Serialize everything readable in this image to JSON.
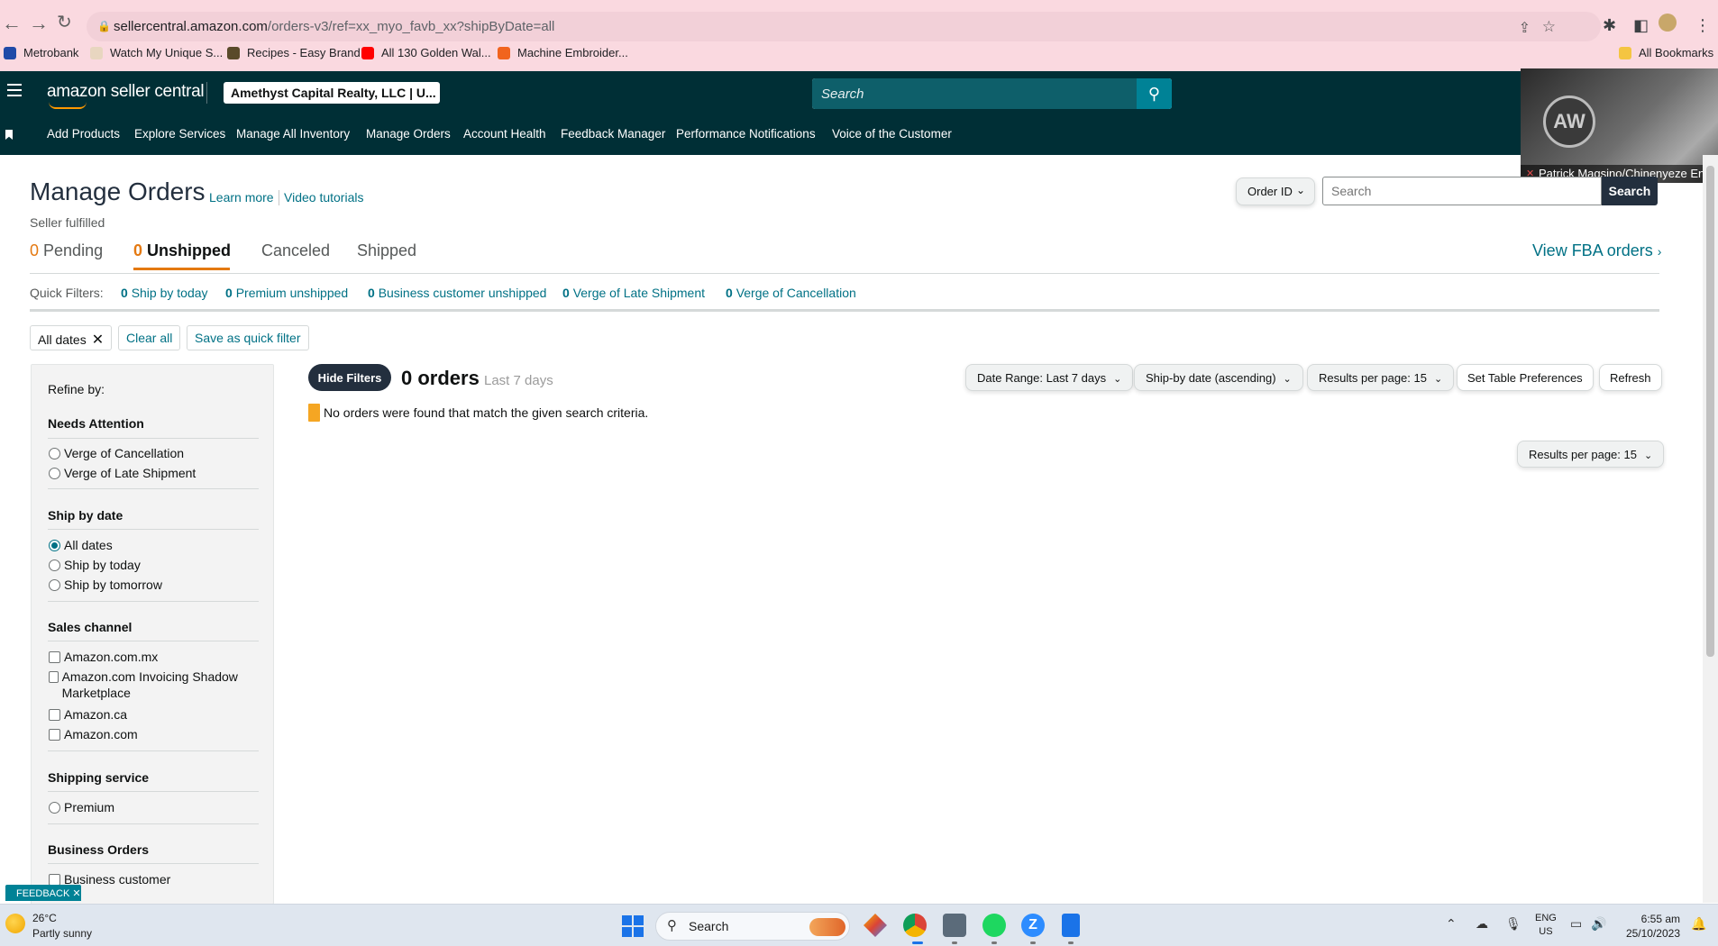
{
  "browser": {
    "url_host": "sellercentral.amazon.com",
    "url_path": "/orders-v3/ref=xx_myo_favb_xx?shipByDate=all",
    "bookmarks": [
      {
        "label": "Metrobank",
        "color": "#1f4aa8"
      },
      {
        "label": "Watch My Unique S...",
        "color": "#e8d6c0"
      },
      {
        "label": "Recipes - Easy Brand",
        "color": "#5a4a2a"
      },
      {
        "label": "All 130 Golden Wal...",
        "color": "#ff0000"
      },
      {
        "label": "Machine Embroider...",
        "color": "#f1641e"
      }
    ],
    "all_bookmarks": "All Bookmarks"
  },
  "header": {
    "logo_text": "amazon seller central",
    "account": "Amethyst Capital Realty, LLC | U...",
    "search_placeholder": "Search",
    "nav": [
      "Add Products",
      "Explore Services",
      "Manage All Inventory",
      "Manage Orders",
      "Account Health",
      "Feedback Manager",
      "Performance Notifications",
      "Voice of the Customer"
    ]
  },
  "video": {
    "participant": "Patrick Magsino/Chinenyeze Enw...",
    "logo_letters": "AW"
  },
  "page": {
    "title": "Manage Orders",
    "learn_more": "Learn more",
    "video_tutorials": "Video tutorials",
    "subtitle": "Seller fulfilled",
    "id_select": "Order ID",
    "search_placeholder": "Search",
    "search_button": "Search",
    "tabs": [
      {
        "count": "0",
        "label": "Pending"
      },
      {
        "count": "0",
        "label": "Unshipped"
      },
      {
        "count": "",
        "label": "Canceled"
      },
      {
        "count": "",
        "label": "Shipped"
      }
    ],
    "fba_link": "View FBA orders",
    "quick_filters_label": "Quick Filters:",
    "quick_filters": [
      {
        "count": "0",
        "label": "Ship by today"
      },
      {
        "count": "0",
        "label": "Premium unshipped"
      },
      {
        "count": "0",
        "label": "Business customer unshipped"
      },
      {
        "count": "0",
        "label": "Verge of Late Shipment"
      },
      {
        "count": "0",
        "label": "Verge of Cancellation"
      }
    ],
    "chip_all_dates": "All dates",
    "chip_clear": "Clear all",
    "chip_save": "Save as quick filter"
  },
  "sidebar": {
    "refine": "Refine by:",
    "needs_attention": "Needs Attention",
    "na_options": [
      "Verge of Cancellation",
      "Verge of Late Shipment"
    ],
    "ship_by": "Ship by date",
    "ship_options": [
      "All dates",
      "Ship by today",
      "Ship by tomorrow"
    ],
    "sales_channel": "Sales channel",
    "channel_options": [
      "Amazon.com.mx",
      "Amazon.com Invoicing Shadow Marketplace",
      "Amazon.ca",
      "Amazon.com"
    ],
    "shipping_service": "Shipping service",
    "service_options": [
      "Premium"
    ],
    "business_orders": "Business Orders",
    "business_options": [
      "Business customer"
    ]
  },
  "results": {
    "hide_filters": "Hide Filters",
    "count": "0 orders",
    "range": "Last 7 days",
    "date_range": "Date Range: Last 7 days",
    "sort": "Ship-by date (ascending)",
    "per_page": "Results per page: 15",
    "table_prefs": "Set Table Preferences",
    "refresh": "Refresh",
    "empty_message": "No orders were found that match the given search criteria.",
    "per_page_bottom": "Results per page: 15"
  },
  "feedback": "FEEDBACK",
  "taskbar": {
    "temp": "26°C",
    "condition": "Partly sunny",
    "search": "Search",
    "lang_1": "ENG",
    "lang_2": "US",
    "time": "6:55 am",
    "date": "25/10/2023"
  }
}
